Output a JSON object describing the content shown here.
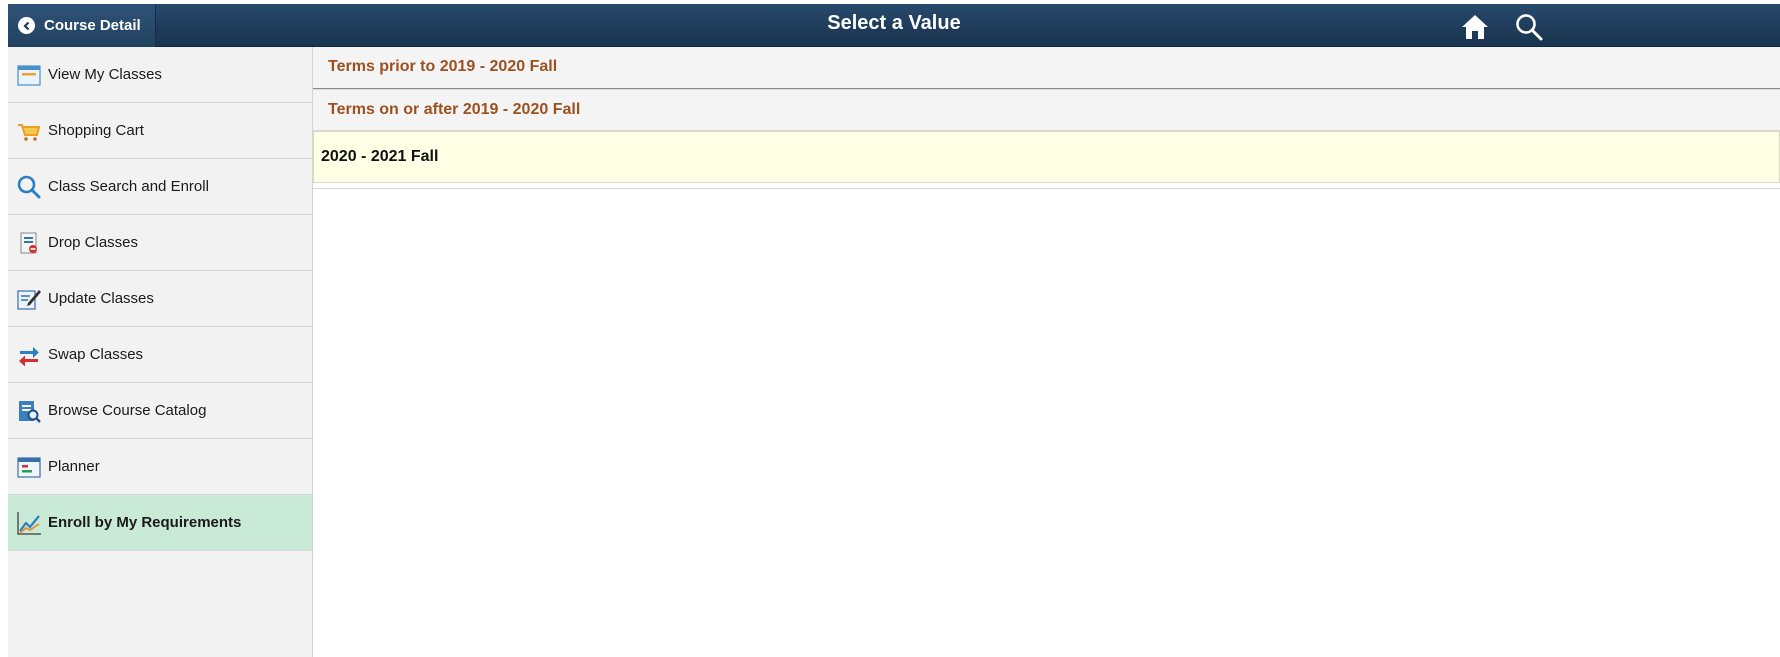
{
  "header": {
    "back_label": "Course Detail",
    "title": "Select a Value",
    "icons": [
      "home-icon",
      "search-icon"
    ]
  },
  "sidebar": {
    "items": [
      {
        "label": "View My Classes",
        "icon": "calendar-icon"
      },
      {
        "label": "Shopping Cart",
        "icon": "cart-icon"
      },
      {
        "label": "Class Search and Enroll",
        "icon": "search-icon"
      },
      {
        "label": "Drop Classes",
        "icon": "drop-icon"
      },
      {
        "label": "Update Classes",
        "icon": "edit-icon"
      },
      {
        "label": "Swap Classes",
        "icon": "swap-icon"
      },
      {
        "label": "Browse Course Catalog",
        "icon": "catalog-icon"
      },
      {
        "label": "Planner",
        "icon": "planner-icon"
      },
      {
        "label": "Enroll by My Requirements",
        "icon": "chart-icon",
        "active": true
      }
    ]
  },
  "main": {
    "groups": [
      {
        "label": "Terms prior to 2019 - 2020 Fall"
      },
      {
        "label": "Terms on or after 2019 - 2020 Fall"
      }
    ],
    "values": [
      {
        "label": "2020 - 2021 Fall"
      }
    ]
  },
  "colors": {
    "header_bg": "#1e3b59",
    "group_text": "#9b5120",
    "active_bg": "#c9ead6",
    "value_bg": "#ffffe5"
  }
}
